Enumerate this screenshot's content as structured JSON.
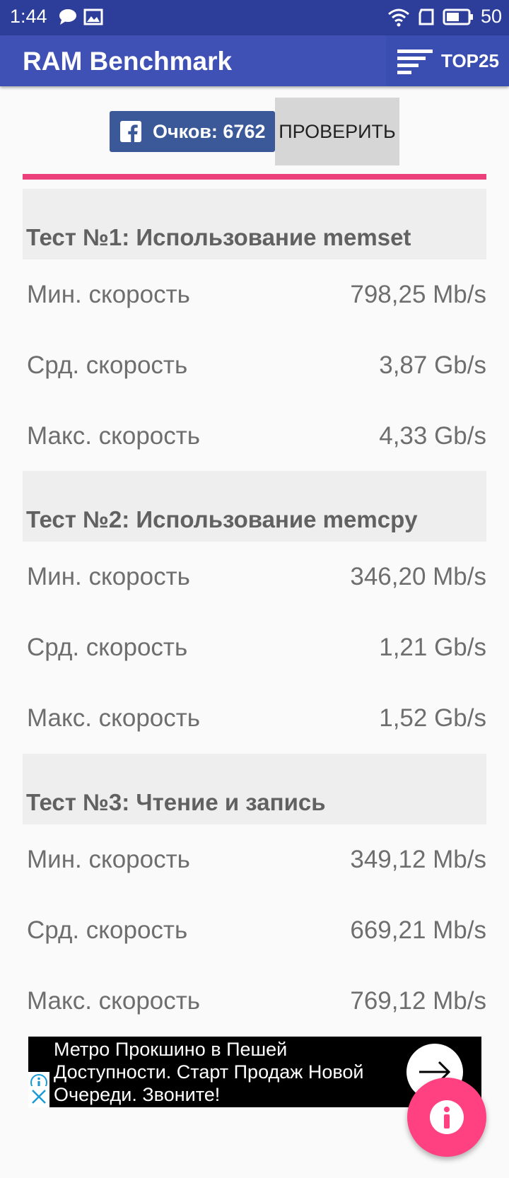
{
  "status_bar": {
    "time": "1:44",
    "battery": "50"
  },
  "app_bar": {
    "title": "RAM Benchmark",
    "top_label": "TOP25"
  },
  "score": {
    "label": "Очков: 6762",
    "check_label": "ПРОВЕРИТЬ"
  },
  "tests": [
    {
      "title": "Тест №1: Использование memset",
      "rows": [
        {
          "label": "Мин. скорость",
          "value": "798,25 Mb/s"
        },
        {
          "label": "Срд. скорость",
          "value": "3,87 Gb/s"
        },
        {
          "label": "Макс. скорость",
          "value": "4,33 Gb/s"
        }
      ]
    },
    {
      "title": "Тест №2: Использование memcpy",
      "rows": [
        {
          "label": "Мин. скорость",
          "value": "346,20 Mb/s"
        },
        {
          "label": "Срд. скорость",
          "value": "1,21 Gb/s"
        },
        {
          "label": "Макс. скорость",
          "value": "1,52 Gb/s"
        }
      ]
    },
    {
      "title": "Тест №3: Чтение и запись",
      "rows": [
        {
          "label": "Мин. скорость",
          "value": "349,12 Mb/s"
        },
        {
          "label": "Срд. скорость",
          "value": "669,21 Mb/s"
        },
        {
          "label": "Макс. скорость",
          "value": "769,12 Mb/s"
        }
      ]
    }
  ],
  "ad": {
    "text": "Метро Прокшино в Пешей Доступности. Старт Продаж Новой Очереди. Звоните!"
  },
  "colors": {
    "status_bar": "#2c3e9a",
    "app_bar": "#3f51b5",
    "accent": "#ec407a",
    "fab": "#ff4081",
    "facebook": "#3b5998"
  },
  "icons": [
    "chat-icon",
    "image-icon",
    "wifi-icon",
    "rotate-icon",
    "battery-icon",
    "sort-icon",
    "facebook-icon",
    "ad-info-icon",
    "ad-close-icon",
    "arrow-right-icon",
    "info-icon"
  ]
}
